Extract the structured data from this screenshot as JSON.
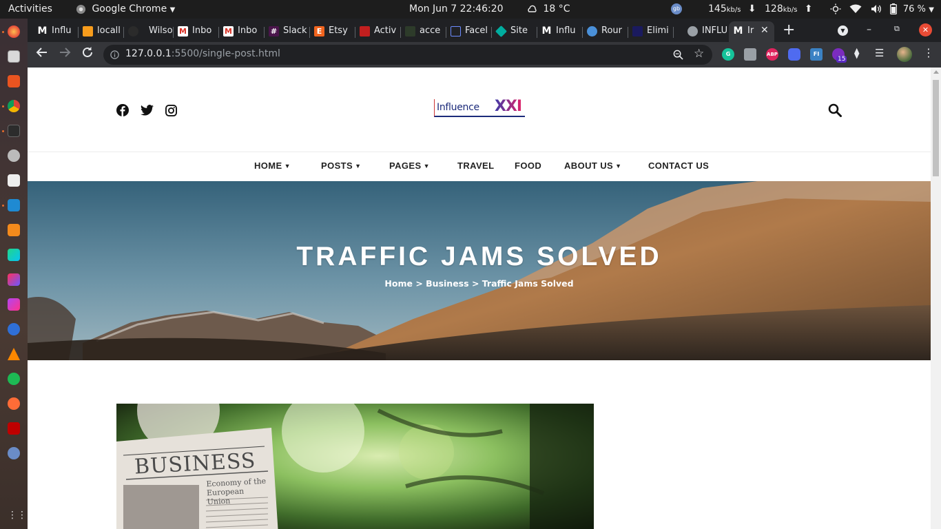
{
  "system": {
    "activities": "Activities",
    "app_name": "Google Chrome",
    "datetime": "Mon Jun 7  22:46:20",
    "weather": "18 °C",
    "net_down": "145",
    "net_down_unit": "kb/s",
    "net_up": "128",
    "net_up_unit": "kb/s",
    "battery": "76 %",
    "icons": [
      "chrome-icon",
      "weather-icon",
      "network-monitor-icon",
      "brightness-icon",
      "wifi-icon",
      "volume-icon",
      "battery-icon"
    ]
  },
  "dock": {
    "apps": [
      "firefox",
      "files",
      "software-center",
      "chrome",
      "terminal",
      "settings",
      "screenshot",
      "vscode",
      "sublime-text",
      "webstorm",
      "intellij",
      "phpstorm",
      "blue-app",
      "vlc",
      "spotify",
      "postman",
      "filezilla",
      "network-app",
      "show-apps"
    ]
  },
  "browser": {
    "tabs": [
      {
        "label": "Influ",
        "icon": "medium-icon"
      },
      {
        "label": "locall",
        "icon": "xampp-icon"
      },
      {
        "label": "Wilso",
        "icon": "github-icon"
      },
      {
        "label": "Inbo",
        "icon": "gmail-icon"
      },
      {
        "label": "Inbo",
        "icon": "gmail-icon"
      },
      {
        "label": "Slack",
        "icon": "slack-icon"
      },
      {
        "label": "Etsy",
        "icon": "etsy-icon"
      },
      {
        "label": "Activ",
        "icon": "activity-icon"
      },
      {
        "label": "acce",
        "icon": "leaf-icon"
      },
      {
        "label": "Facel",
        "icon": "flag-icon"
      },
      {
        "label": "Site",
        "icon": "diamond-icon"
      },
      {
        "label": "Influ",
        "icon": "medium-icon"
      },
      {
        "label": "Rour",
        "icon": "globe-icon"
      },
      {
        "label": "Elimi",
        "icon": "wave-icon"
      },
      {
        "label": "INFLU",
        "icon": "world-icon"
      },
      {
        "label": "Ir",
        "icon": "medium-icon",
        "active": true
      }
    ],
    "new_tab": "+",
    "url_host": "127.0.0.1",
    "url_rest": ":5500/single-post.html",
    "extensions": [
      {
        "name": "grammarly-icon",
        "text": "G",
        "color": "#15c39a"
      },
      {
        "name": "ext-gray-icon",
        "text": "",
        "color": "#9aa0a6"
      },
      {
        "name": "adblock-icon",
        "text": "ABP",
        "color": "#e0245e"
      },
      {
        "name": "zoom-icon",
        "text": "",
        "color": "#4f6bf0"
      },
      {
        "name": "fonts-ninja-icon",
        "text": "FI",
        "color": "#3b82c4"
      },
      {
        "name": "ext-purple-icon",
        "text": "",
        "color": "#7b2cbf"
      },
      {
        "name": "extensions-icon",
        "text": "",
        "color": "#35363a"
      }
    ],
    "ext_badge": "15"
  },
  "page": {
    "header": {
      "social": [
        "facebook-icon",
        "twitter-icon",
        "instagram-icon"
      ],
      "logo_text": "Influence",
      "logo_suffix": "XXI"
    },
    "nav": [
      {
        "label": "HOME",
        "dropdown": true
      },
      {
        "label": "POSTS",
        "dropdown": true
      },
      {
        "label": "PAGES",
        "dropdown": true
      },
      {
        "label": "TRAVEL",
        "dropdown": false
      },
      {
        "label": "FOOD",
        "dropdown": false
      },
      {
        "label": "ABOUT US",
        "dropdown": true
      },
      {
        "label": "CONTACT US",
        "dropdown": false
      }
    ],
    "hero": {
      "title": "TRAFFIC JAMS SOLVED",
      "breadcrumb": [
        "Home",
        "Business",
        "Traffic Jams Solved"
      ],
      "separator": ">"
    },
    "post_image": {
      "headline": "BUSINESS",
      "subhead": "Economy of the European Union"
    }
  }
}
